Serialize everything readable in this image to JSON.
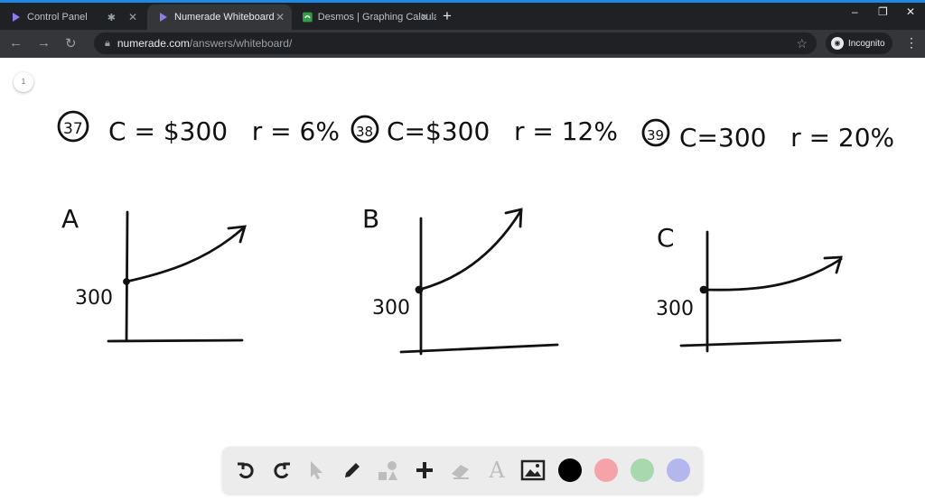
{
  "browser": {
    "tabs": [
      {
        "title": "Control Panel",
        "icon": "numerade-icon",
        "active": false
      },
      {
        "title": "Numerade Whiteboard",
        "icon": "numerade-icon",
        "active": true
      },
      {
        "title": "Desmos | Graphing Calculator",
        "icon": "desmos-icon",
        "active": false
      }
    ],
    "url_host": "numerade.com",
    "url_path": "/answers/whiteboard/",
    "incognito_label": "Incognito"
  },
  "whiteboard": {
    "page_number": "1",
    "problems": [
      {
        "number": "37",
        "text": "C = $300   r = 6%"
      },
      {
        "number": "38",
        "text": "C=$300   r = 12%"
      },
      {
        "number": "39",
        "text": "C=300   r = 20%"
      }
    ],
    "graphs": [
      {
        "letter": "A",
        "y_label": "300"
      },
      {
        "letter": "B",
        "y_label": "300"
      },
      {
        "letter": "C",
        "y_label": "300"
      }
    ]
  },
  "palette": {
    "tools": [
      "undo-icon",
      "redo-icon",
      "pointer-icon",
      "pen-icon",
      "shapes-icon",
      "add-icon",
      "eraser-icon",
      "text-icon",
      "image-icon"
    ],
    "colors": [
      "#000000",
      "#f4a3a8",
      "#a8d8ad",
      "#b3b7ee"
    ]
  }
}
